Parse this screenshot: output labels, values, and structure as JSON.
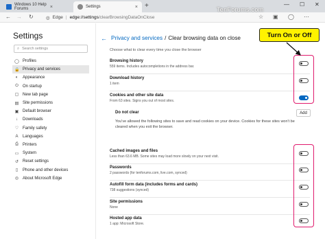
{
  "browser": {
    "tabs": [
      {
        "label": "Windows 10 Help Forums",
        "close": "×"
      },
      {
        "label": "Settings",
        "close": "×"
      }
    ],
    "new_tab": "+",
    "window_controls": [
      "—",
      "☐",
      "✕"
    ],
    "watermark": "TenForums.com",
    "address": {
      "edge_label": "Edge",
      "url_host": "edge://settings",
      "url_path": "/clearBrowsingDataOnClose"
    }
  },
  "sidebar": {
    "title": "Settings",
    "search_placeholder": "Search settings",
    "items": [
      {
        "label": "Profiles",
        "icon": "person-icon",
        "glyph": "◯"
      },
      {
        "label": "Privacy and services",
        "icon": "lock-icon",
        "glyph": "🔒"
      },
      {
        "label": "Appearance",
        "icon": "palette-icon",
        "glyph": "◐"
      },
      {
        "label": "On startup",
        "icon": "power-icon",
        "glyph": "⏻"
      },
      {
        "label": "New tab page",
        "icon": "newtab-icon",
        "glyph": "▢"
      },
      {
        "label": "Site permissions",
        "icon": "site-permissions-icon",
        "glyph": "▤"
      },
      {
        "label": "Default browser",
        "icon": "browser-icon",
        "glyph": "▣"
      },
      {
        "label": "Downloads",
        "icon": "download-icon",
        "glyph": "↓"
      },
      {
        "label": "Family safety",
        "icon": "family-icon",
        "glyph": "♡"
      },
      {
        "label": "Languages",
        "icon": "language-icon",
        "glyph": "A"
      },
      {
        "label": "Printers",
        "icon": "printer-icon",
        "glyph": "⎙"
      },
      {
        "label": "System",
        "icon": "system-icon",
        "glyph": "▭"
      },
      {
        "label": "Reset settings",
        "icon": "reset-icon",
        "glyph": "↺"
      },
      {
        "label": "Phone and other devices",
        "icon": "phone-icon",
        "glyph": "▯"
      },
      {
        "label": "About Microsoft Edge",
        "icon": "edge-logo-icon",
        "glyph": "◎"
      }
    ]
  },
  "main": {
    "breadcrumb_parent": "Privacy and services",
    "breadcrumb_sep": "/",
    "breadcrumb_current": "Clear browsing data on close",
    "subtitle": "Choose what to clear every time you close the browser",
    "settings": [
      {
        "title": "Browsing history",
        "desc": "559 items. Includes autocompletions in the address bar.",
        "on": false
      },
      {
        "title": "Download history",
        "desc": "1 item",
        "on": false
      },
      {
        "title": "Cookies and other site data",
        "desc": "From 63 sites. Signs you out of most sites.",
        "on": true
      }
    ],
    "do_not_clear": {
      "title": "Do not clear",
      "add_label": "Add",
      "desc": "You've allowed the following sites to save and read cookies on your device. Cookies for these sites won't be cleared when you exit the browser."
    },
    "settings2": [
      {
        "title": "Cached images and files",
        "desc": "Less than 63.6 MB. Some sites may load more slowly on your next visit.",
        "on": false
      },
      {
        "title": "Passwords",
        "desc": "2 passwords (for tenforums.com, live.com, synced)",
        "on": false
      },
      {
        "title": "Autofill form data (includes forms and cards)",
        "desc": "738 suggestions (synced)",
        "on": false
      },
      {
        "title": "Site permissions",
        "desc": "None",
        "on": false
      },
      {
        "title": "Hosted app data",
        "desc": "1 app: Microsoft Store.",
        "on": false
      }
    ]
  },
  "annotation": {
    "callout": "Turn On or Off",
    "callout_color": "#fff200",
    "highlight_color": "#e0196c"
  }
}
